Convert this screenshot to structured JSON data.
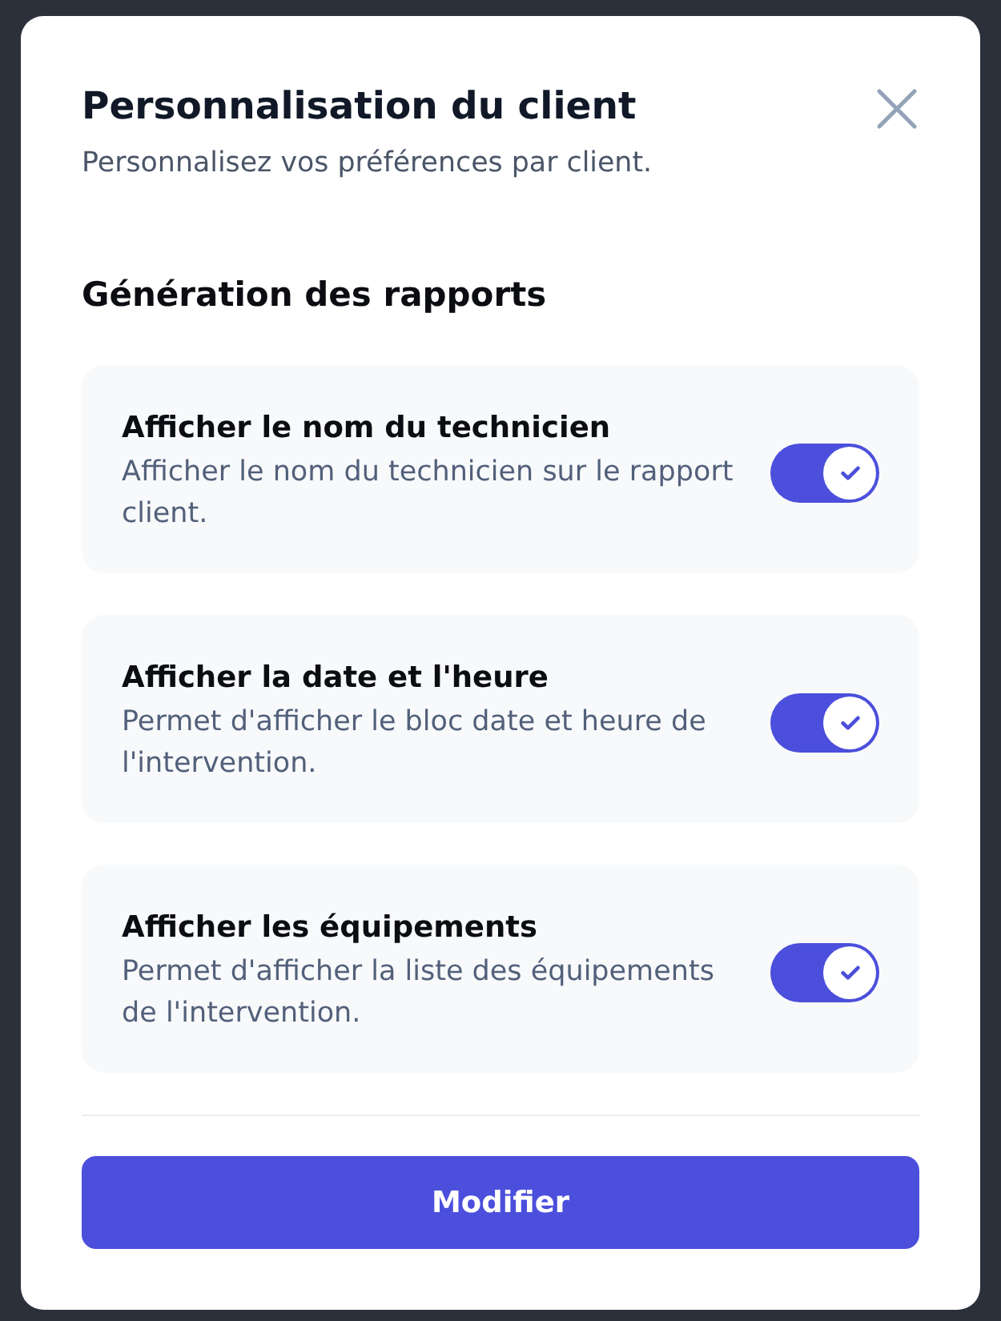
{
  "dialog": {
    "title": "Personnalisation du client",
    "subtitle": "Personnalisez vos préférences par client."
  },
  "section": {
    "title": "Génération des rapports"
  },
  "settings": [
    {
      "title": "Afficher le nom du technicien",
      "description": "Afficher le nom du technicien sur le rapport client.",
      "on": true
    },
    {
      "title": "Afficher la date et l'heure",
      "description": "Permet d'afficher le bloc date et heure de l'intervention.",
      "on": true
    },
    {
      "title": "Afficher les équipements",
      "description": "Permet d'afficher la liste des équipements de l'intervention.",
      "on": true
    }
  ],
  "primary_button": {
    "label": "Modifier"
  }
}
